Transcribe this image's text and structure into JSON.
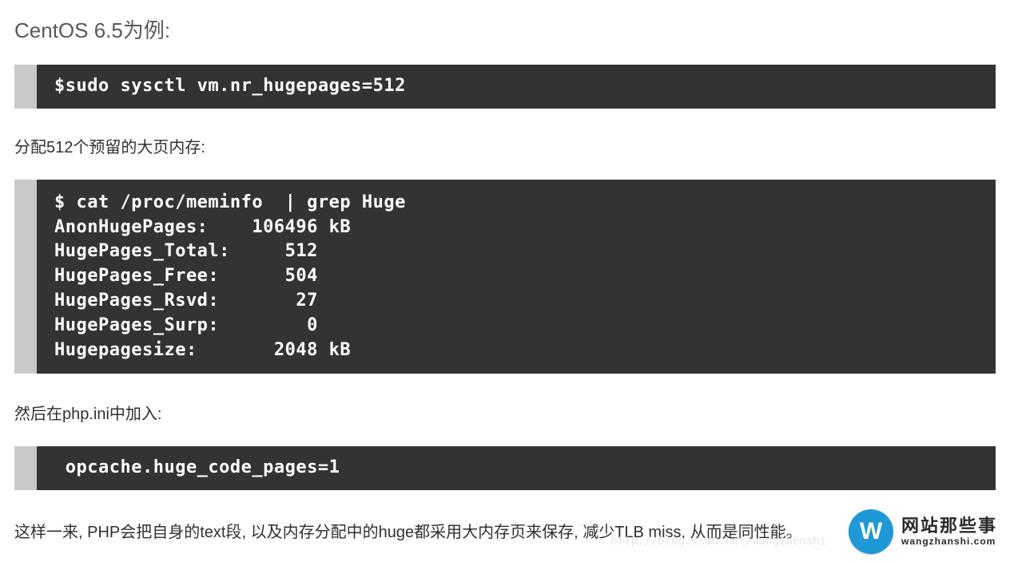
{
  "heading": "CentOS 6.5为例:",
  "code1": "$sudo sysctl vm.nr_hugepages=512",
  "para1": "分配512个预留的大页内存:",
  "code2": "$ cat /proc/meminfo  | grep Huge\nAnonHugePages:    106496 kB\nHugePages_Total:     512\nHugePages_Free:      504\nHugePages_Rsvd:       27\nHugePages_Surp:        0\nHugepagesize:       2048 kB",
  "para2": "然后在php.ini中加入:",
  "code3": " opcache.huge_code_pages=1",
  "para3": "这样一来, PHP会把自身的text段, 以及内存分配中的huge都采用大内存页来保存, 减少TLB miss, 从而是同性能。",
  "faint_url": "http://blog.csdn.net/wangzhenshi",
  "logo": {
    "badge": "W",
    "cn": "网站那些事",
    "en": "wangzhanshi.com"
  }
}
